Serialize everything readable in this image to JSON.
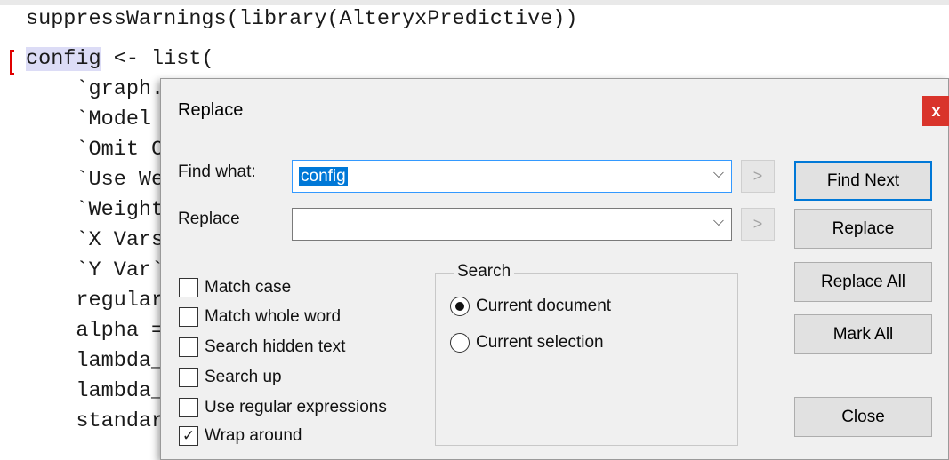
{
  "editor": {
    "lines": [
      {
        "pre": "",
        "hl": "",
        "post": "suppressWarnings(library(AlteryxPredictive))"
      },
      {
        "pre": "",
        "hl": "config",
        "post": " <- list("
      },
      {
        "pre": "",
        "hl": "",
        "post": "    `graph."
      },
      {
        "pre": "",
        "hl": "",
        "post": "    `Model "
      },
      {
        "pre": "",
        "hl": "",
        "post": "    `Omit C"
      },
      {
        "pre": "",
        "hl": "",
        "post": "    `Use We"
      },
      {
        "pre": "",
        "hl": "",
        "post": "    `Weight"
      },
      {
        "pre": "",
        "hl": "",
        "post": "    `X Vars"
      },
      {
        "pre": "",
        "hl": "",
        "post": "    `Y Var`"
      },
      {
        "pre": "",
        "hl": "",
        "post": "    regular"
      },
      {
        "pre": "",
        "hl": "",
        "post": "    alpha ="
      },
      {
        "pre": "",
        "hl": "",
        "post": "    lambda_"
      },
      {
        "pre": "",
        "hl": "",
        "post": "    lambda_"
      },
      {
        "pre": "",
        "hl": "",
        "post": "    standar"
      }
    ]
  },
  "dialog": {
    "title": "Replace",
    "close_symbol": "x",
    "find_label": "Find what:",
    "find_value": "config",
    "replace_label": "Replace",
    "replace_value": "",
    "dropdown_symbol": "⌵",
    "history_symbol": ">",
    "buttons": {
      "find_next": "Find Next",
      "replace": "Replace",
      "replace_all": "Replace All",
      "mark_all": "Mark All",
      "close": "Close"
    },
    "options": [
      {
        "label": "Match case",
        "checked": false
      },
      {
        "label": "Match whole word",
        "checked": false
      },
      {
        "label": "Search hidden text",
        "checked": false
      },
      {
        "label": "Search up",
        "checked": false
      },
      {
        "label": "Use regular expressions",
        "checked": false
      },
      {
        "label": "Wrap around",
        "checked": true
      }
    ],
    "search_group": {
      "label": "Search",
      "options": [
        {
          "label": "Current document",
          "selected": true
        },
        {
          "label": "Current selection",
          "selected": false
        }
      ]
    }
  }
}
